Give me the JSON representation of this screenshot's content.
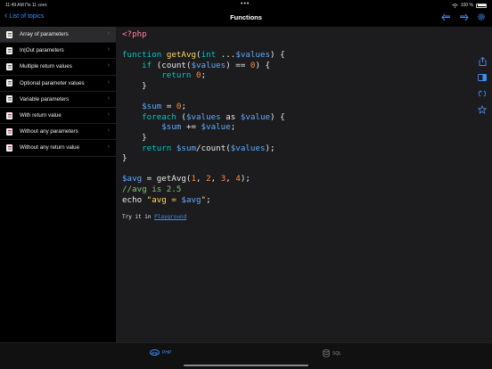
{
  "status": {
    "time": "11:49 AM",
    "date": "Пн 11 сент.",
    "battery": "100 %"
  },
  "nav": {
    "back_label": "List of topics",
    "title": "Functions"
  },
  "sidebar": {
    "items": [
      {
        "label": "Array of parameters"
      },
      {
        "label": "In|Out parameters"
      },
      {
        "label": "Multiple return values"
      },
      {
        "label": "Optional parameter values"
      },
      {
        "label": "Variable parameters"
      },
      {
        "label": "With return value"
      },
      {
        "label": "Without any parameters"
      },
      {
        "label": "Without any return value"
      }
    ],
    "active_index": 0
  },
  "editor": {
    "try_text": "Try it in ",
    "try_link": "Playground"
  },
  "tabs": {
    "php_label": "PHP",
    "sql_label": "SQL"
  },
  "colors": {
    "accent": "#3d8ef5",
    "background": "#1c1c1e"
  },
  "icons": [
    "back-arrow-icon",
    "forward-arrow-icon",
    "settings-gear-icon",
    "share-icon",
    "toggle-sidebar-icon",
    "swap-icon",
    "bookmark-star-icon",
    "database-icon"
  ]
}
